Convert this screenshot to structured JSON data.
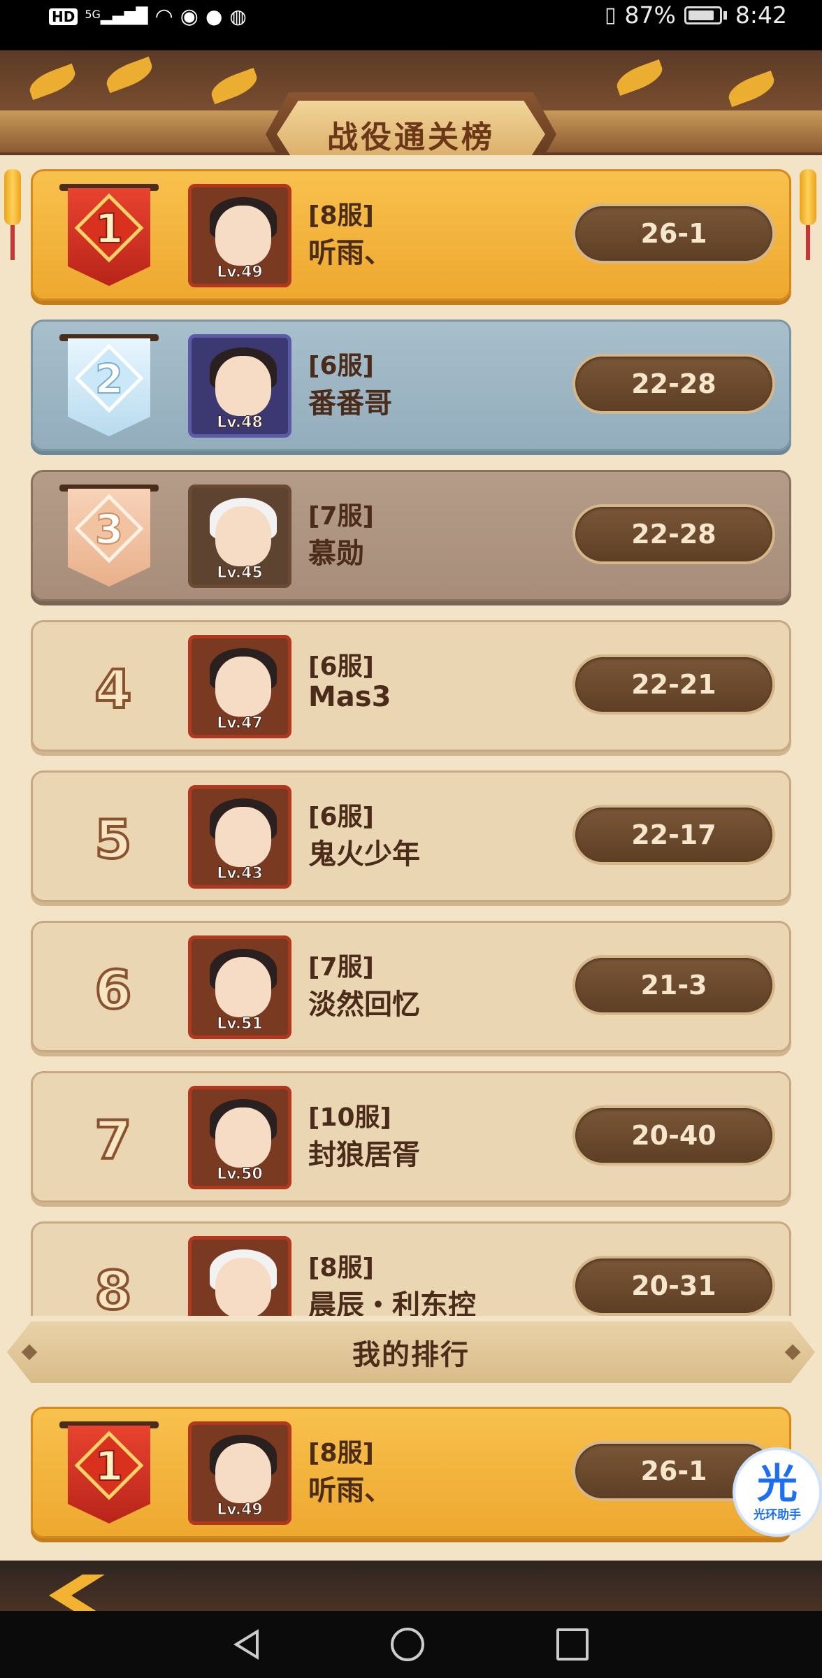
{
  "status_bar": {
    "hd_label": "HD",
    "network_label": "5G",
    "battery_percent": "87%",
    "time": "8:42"
  },
  "page": {
    "title": "战役通关榜",
    "my_rank_label": "我的排行",
    "helper_glyph": "光",
    "helper_label": "光环助手"
  },
  "leaderboard": [
    {
      "rank": "1",
      "server": "[8服]",
      "name": "听雨、",
      "level": "Lv.49",
      "score": "26-1",
      "tier": "gold"
    },
    {
      "rank": "2",
      "server": "[6服]",
      "name": "番番哥",
      "level": "Lv.48",
      "score": "22-28",
      "tier": "silver"
    },
    {
      "rank": "3",
      "server": "[7服]",
      "name": "慕勋",
      "level": "Lv.45",
      "score": "22-28",
      "tier": "bronze"
    },
    {
      "rank": "4",
      "server": "[6服]",
      "name": "Mas3",
      "level": "Lv.47",
      "score": "22-21",
      "tier": "normal"
    },
    {
      "rank": "5",
      "server": "[6服]",
      "name": "鬼火少年",
      "level": "Lv.43",
      "score": "22-17",
      "tier": "normal"
    },
    {
      "rank": "6",
      "server": "[7服]",
      "name": "淡然回忆",
      "level": "Lv.51",
      "score": "21-3",
      "tier": "normal"
    },
    {
      "rank": "7",
      "server": "[10服]",
      "name": "封狼居胥",
      "level": "Lv.50",
      "score": "20-40",
      "tier": "normal"
    },
    {
      "rank": "8",
      "server": "[8服]",
      "name": "晨辰・利东控",
      "level": "",
      "score": "20-31",
      "tier": "normal"
    }
  ],
  "my_rank": {
    "rank": "1",
    "server": "[8服]",
    "name": "听雨、",
    "level": "Lv.49",
    "score": "26-1",
    "tier": "gold"
  }
}
